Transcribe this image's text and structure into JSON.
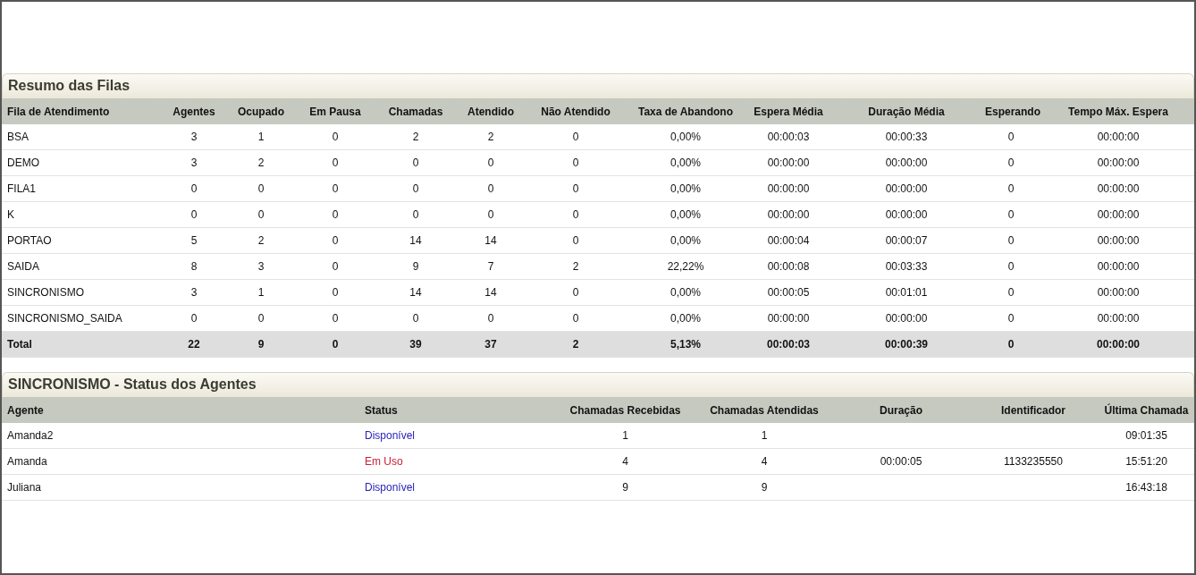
{
  "queue_summary": {
    "title": "Resumo das Filas",
    "columns": [
      "Fila de Atendimento",
      "Agentes",
      "Ocupado",
      "Em Pausa",
      "Chamadas",
      "Atendido",
      "Não Atendido",
      "Taxa de Abandono",
      "Espera Média",
      "Duração Média",
      "Esperando",
      "Tempo Máx. Espera"
    ],
    "rows": [
      {
        "cells": [
          "BSA",
          "3",
          "1",
          "0",
          "2",
          "2",
          "0",
          "0,00%",
          "00:00:03",
          "00:00:33",
          "0",
          "00:00:00"
        ]
      },
      {
        "cells": [
          "DEMO",
          "3",
          "2",
          "0",
          "0",
          "0",
          "0",
          "0,00%",
          "00:00:00",
          "00:00:00",
          "0",
          "00:00:00"
        ]
      },
      {
        "cells": [
          "FILA1",
          "0",
          "0",
          "0",
          "0",
          "0",
          "0",
          "0,00%",
          "00:00:00",
          "00:00:00",
          "0",
          "00:00:00"
        ]
      },
      {
        "cells": [
          "K",
          "0",
          "0",
          "0",
          "0",
          "0",
          "0",
          "0,00%",
          "00:00:00",
          "00:00:00",
          "0",
          "00:00:00"
        ]
      },
      {
        "cells": [
          "PORTAO",
          "5",
          "2",
          "0",
          "14",
          "14",
          "0",
          "0,00%",
          "00:00:04",
          "00:00:07",
          "0",
          "00:00:00"
        ]
      },
      {
        "cells": [
          "SAIDA",
          "8",
          "3",
          "0",
          "9",
          "7",
          "2",
          "22,22%",
          "00:00:08",
          "00:03:33",
          "0",
          "00:00:00"
        ]
      },
      {
        "cells": [
          "SINCRONISMO",
          "3",
          "1",
          "0",
          "14",
          "14",
          "0",
          "0,00%",
          "00:00:05",
          "00:01:01",
          "0",
          "00:00:00"
        ]
      },
      {
        "cells": [
          "SINCRONISMO_SAIDA",
          "0",
          "0",
          "0",
          "0",
          "0",
          "0",
          "0,00%",
          "00:00:00",
          "00:00:00",
          "0",
          "00:00:00"
        ]
      }
    ],
    "total": {
      "cells": [
        "Total",
        "22",
        "9",
        "0",
        "39",
        "37",
        "2",
        "5,13%",
        "00:00:03",
        "00:00:39",
        "0",
        "00:00:00"
      ]
    }
  },
  "agent_status": {
    "title": "SINCRONISMO - Status dos Agentes",
    "columns": [
      "Agente",
      "Status",
      "Chamadas Recebidas",
      "Chamadas Atendidas",
      "Duração",
      "Identificador",
      "Última Chamada"
    ],
    "rows": [
      {
        "agent": "Amanda2",
        "status": "Disponível",
        "kind": "available",
        "received": "1",
        "answered": "1",
        "duration": "",
        "caller_id": "",
        "last_call": "09:01:35"
      },
      {
        "agent": "Amanda",
        "status": "Em Uso",
        "kind": "busy",
        "received": "4",
        "answered": "4",
        "duration": "00:00:05",
        "caller_id": "1133235550",
        "last_call": "15:51:20"
      },
      {
        "agent": "Juliana",
        "status": "Disponível",
        "kind": "available",
        "received": "9",
        "answered": "9",
        "duration": "",
        "caller_id": "",
        "last_call": "16:43:18"
      }
    ]
  }
}
